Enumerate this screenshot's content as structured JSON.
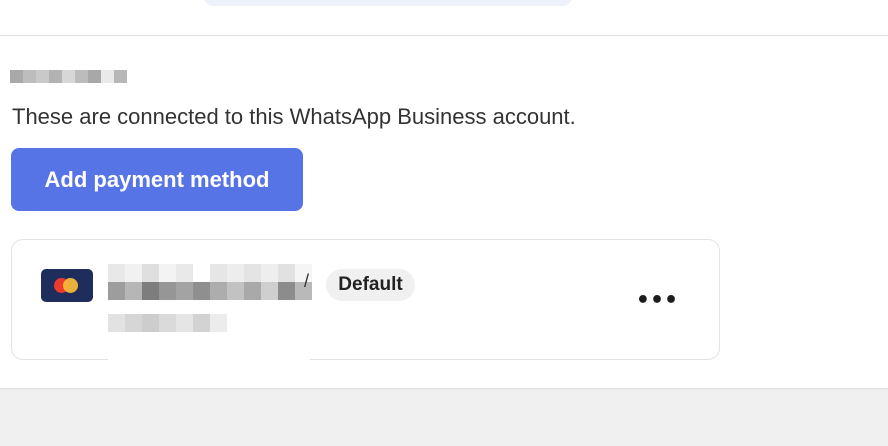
{
  "section": {
    "description": "These are connected to this WhatsApp Business account.",
    "add_button_label": "Add payment method",
    "accent_color": "#5774e6"
  },
  "payment_card": {
    "brand_icon": "mastercard-icon",
    "badge_label": "Default",
    "more_options_icon": "•••",
    "name_fragment": "/",
    "details_redacted": true
  },
  "redacted_heading": true
}
